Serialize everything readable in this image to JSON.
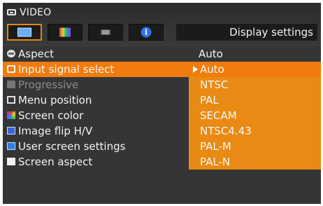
{
  "window": {
    "title": "VIDEO"
  },
  "tabs": [
    {
      "id": "display",
      "icon": "monitor-icon",
      "active": true
    },
    {
      "id": "color",
      "icon": "color-bars-icon",
      "active": false
    },
    {
      "id": "panel",
      "icon": "panel-icon",
      "active": false
    },
    {
      "id": "info",
      "icon": "info-icon",
      "glyph": "i",
      "active": false
    }
  ],
  "context": {
    "label": "Display settings"
  },
  "menu": {
    "items": [
      {
        "label": "Aspect",
        "icon": "aspect-icon",
        "value": "Auto",
        "state": "normal"
      },
      {
        "label": "Input signal select",
        "icon": "input-signal-icon",
        "value": "Auto",
        "state": "selected"
      },
      {
        "label": "Progressive",
        "icon": "progressive-icon",
        "value": "NTSC",
        "state": "disabled"
      },
      {
        "label": "Menu position",
        "icon": "menu-position-icon",
        "value": "PAL",
        "state": "normal"
      },
      {
        "label": "Screen color",
        "icon": "screen-color-icon",
        "value": "SECAM",
        "state": "normal"
      },
      {
        "label": "Image flip H/V",
        "icon": "image-flip-icon",
        "value": "NTSC4.43",
        "state": "normal"
      },
      {
        "label": "User screen settings",
        "icon": "user-screen-icon",
        "value": "PAL-M",
        "state": "normal"
      },
      {
        "label": "Screen aspect",
        "icon": "screen-aspect-icon",
        "value": "PAL-N",
        "state": "normal"
      }
    ]
  },
  "colors": {
    "highlight": "#f07c0e",
    "option_cell": "#e88a14",
    "background": "#353535",
    "active_tab_border": "#e8860e"
  }
}
